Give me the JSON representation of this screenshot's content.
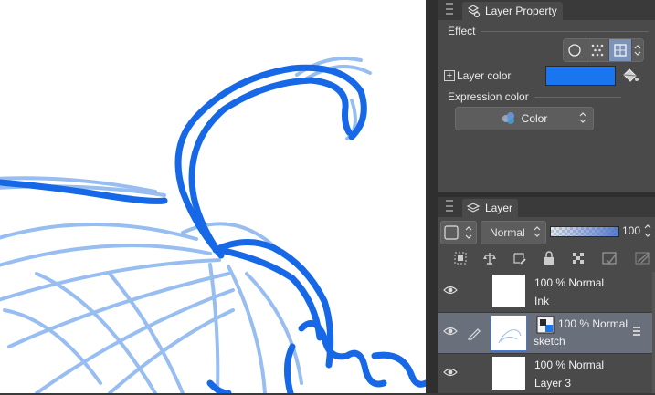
{
  "property_panel": {
    "tab_label": "Layer Property",
    "effect_label": "Effect",
    "layer_color_label": "Layer color",
    "layer_color_value": "#1976f0",
    "expression_color_label": "Expression color",
    "expression_color_value": "Color"
  },
  "layer_panel": {
    "tab_label": "Layer",
    "blend_mode": "Normal",
    "opacity": "100",
    "layers": [
      {
        "opacity_mode": "100 % Normal",
        "name": "Ink",
        "active": false
      },
      {
        "opacity_mode": "100 % Normal",
        "name": "sketch",
        "active": true
      },
      {
        "opacity_mode": "100 % Normal",
        "name": "Layer 3",
        "active": false
      }
    ]
  },
  "colors": {
    "accent": "#1976f0",
    "sketch_stroke": "#6fa3ea",
    "ink_stroke": "#1668e6",
    "panel_bg": "#4a4a4a",
    "active_row": "#6a6f7c"
  }
}
